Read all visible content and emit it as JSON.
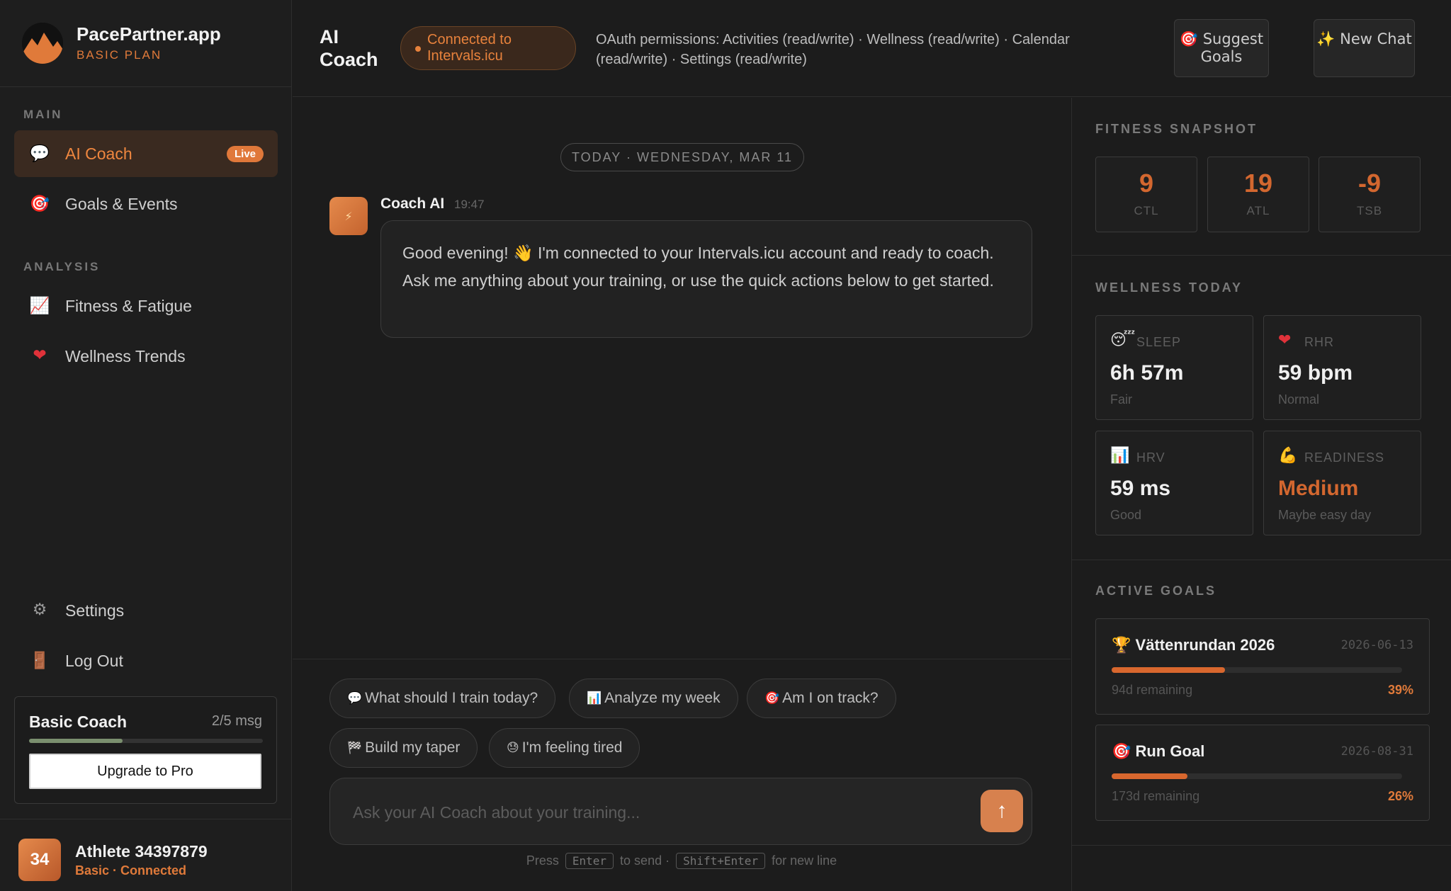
{
  "brand": {
    "name": "PacePartner.app",
    "plan": "BASIC PLAN"
  },
  "sidebar": {
    "main_label": "MAIN",
    "analysis_label": "ANALYSIS",
    "items": [
      {
        "label": "AI Coach",
        "icon": "speech-bubble-icon",
        "glyph": "💬",
        "active": true,
        "badge": "Live"
      },
      {
        "label": "Goals & Events",
        "icon": "target-icon",
        "glyph": "🎯"
      },
      {
        "label": "Fitness & Fatigue",
        "icon": "chart-up-icon",
        "glyph": "📈"
      },
      {
        "label": "Wellness Trends",
        "icon": "heart-icon",
        "glyph": "❤"
      },
      {
        "label": "Settings",
        "icon": "gear-icon",
        "glyph": "⚙"
      },
      {
        "label": "Log Out",
        "icon": "door-icon",
        "glyph": "🚪"
      }
    ],
    "plan_card": {
      "title": "Basic Coach",
      "count": "2/5 msg",
      "usage": 0.4,
      "upgrade_label": "Upgrade to Pro"
    },
    "user": {
      "initials": "34",
      "name": "Athlete 34397879",
      "status": "Basic · Connected"
    }
  },
  "header": {
    "title": "AI Coach",
    "connection": "Connected to Intervals.icu",
    "oauth": "OAuth permissions: Activities (read/write) · Wellness (read/write) · Calendar (read/write) · Settings (read/write)",
    "suggest_label": "🎯 Suggest Goals",
    "new_chat_label": "✨ New Chat"
  },
  "chat": {
    "date": "TODAY · WEDNESDAY, MAR 11",
    "coach_name": "Coach AI",
    "time": "19:47",
    "avatar_glyph": "⚡",
    "message": "Good evening! 👋 I'm connected to your Intervals.icu account and ready to coach. Ask me anything about your training, or use the quick actions below to get started.",
    "quick_actions": [
      {
        "glyph": "💬",
        "label": "What should I train today?"
      },
      {
        "glyph": "📊",
        "label": "Analyze my week"
      },
      {
        "glyph": "🎯",
        "label": "Am I on track?"
      },
      {
        "glyph": "🏁",
        "label": "Build my taper"
      },
      {
        "glyph": "😓",
        "label": "I'm feeling tired"
      }
    ],
    "input_placeholder": "Ask your AI Coach about your training...",
    "send_glyph": "↑",
    "hint": {
      "press": "Press",
      "enter": "Enter",
      "to_send": "to send ·",
      "shift_enter": "Shift+Enter",
      "new_line": "for new line"
    }
  },
  "fitness": {
    "label": "FITNESS SNAPSHOT",
    "items": [
      {
        "value": "9",
        "label": "CTL"
      },
      {
        "value": "19",
        "label": "ATL"
      },
      {
        "value": "-9",
        "label": "TSB"
      }
    ]
  },
  "wellness": {
    "label": "WELLNESS TODAY",
    "items": [
      {
        "glyph": "😴",
        "label": "SLEEP",
        "value": "6h 57m",
        "sub": "Fair"
      },
      {
        "glyph": "❤",
        "label": "RHR",
        "value": "59 bpm",
        "sub": "Normal"
      },
      {
        "glyph": "📊",
        "label": "HRV",
        "value": "59 ms",
        "sub": "Good"
      },
      {
        "glyph": "💪",
        "label": "READINESS",
        "value": "Medium",
        "sub": "Maybe easy day"
      }
    ]
  },
  "goals": {
    "label": "ACTIVE GOALS",
    "items": [
      {
        "glyph": "🏆",
        "name": "Vättenrundan 2026",
        "date": "2026-06-13",
        "remaining": "94d remaining",
        "pct": "39%",
        "progress": 0.39
      },
      {
        "glyph": "🎯",
        "name": "Run Goal",
        "date": "2026-08-31",
        "remaining": "173d remaining",
        "pct": "26%",
        "progress": 0.26
      }
    ]
  },
  "colors": {
    "accent": "#e07a3a",
    "background": "#1b1b1b"
  }
}
